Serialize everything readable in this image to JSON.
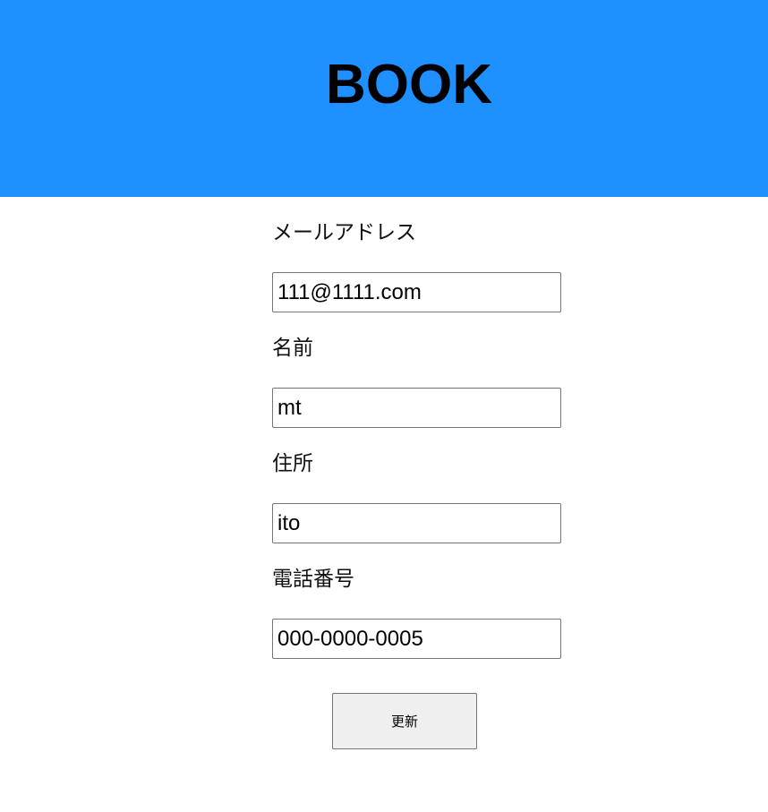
{
  "header": {
    "title": "BOOK",
    "background_color": "#1e90ff"
  },
  "form": {
    "email_label": "メールアドレス",
    "email_value": "111@1111.com",
    "name_label": "名前",
    "name_value": "mt",
    "address_label": "住所",
    "address_value": "ito",
    "phone_label": "電話番号",
    "phone_value": "000-0000-0005",
    "submit_label": "更新"
  }
}
